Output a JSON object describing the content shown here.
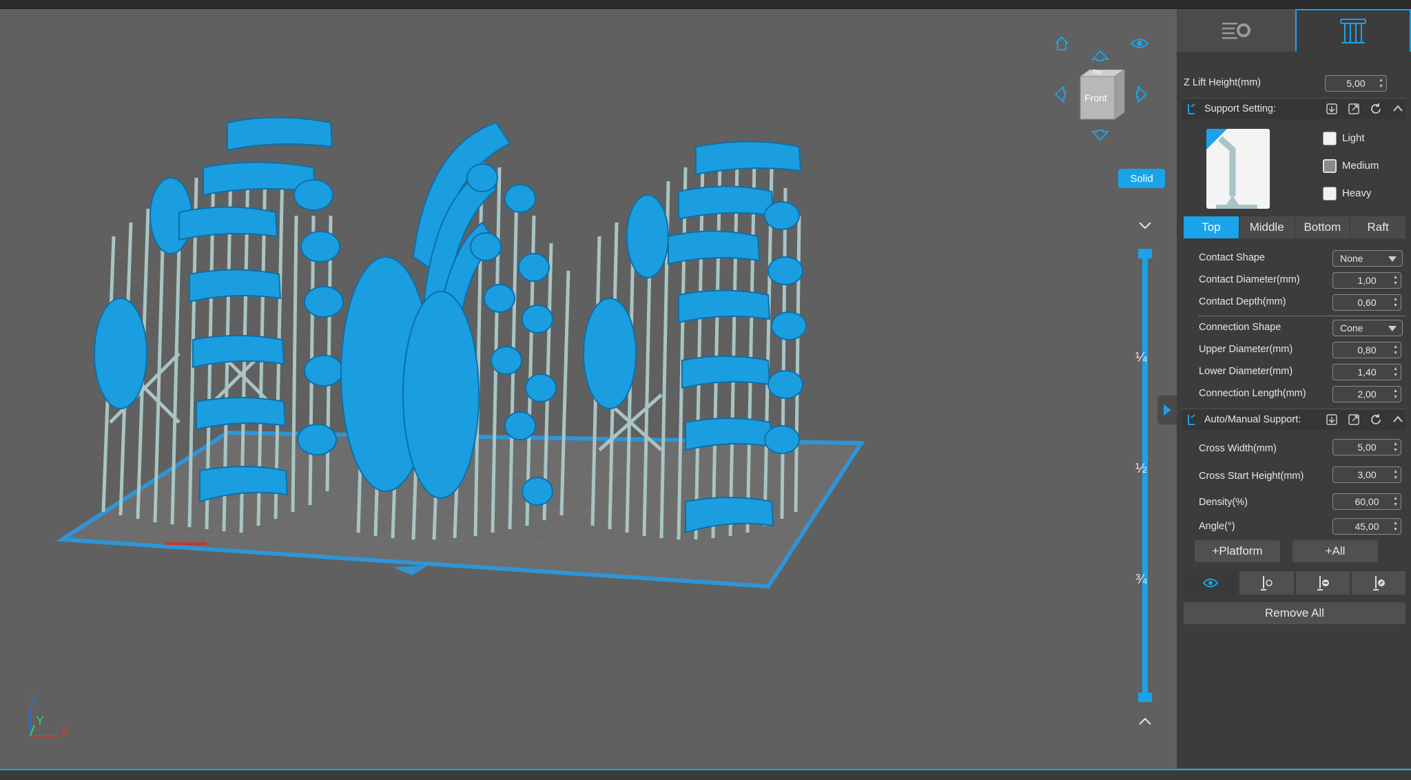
{
  "viewport": {
    "view_cube_face": "Front",
    "view_cube_top": "Top",
    "render_mode_label": "Solid",
    "slider_ticks": [
      "¼",
      "½",
      "¾"
    ],
    "axes": {
      "z": "Z",
      "y": "Y",
      "x": "X"
    }
  },
  "panel": {
    "z_lift": {
      "label": "Z Lift Height(mm)",
      "value": "5,00"
    },
    "support_setting": {
      "title": "Support Setting:",
      "presets": [
        {
          "label": "Light",
          "checked": false
        },
        {
          "label": "Medium",
          "checked": true
        },
        {
          "label": "Heavy",
          "checked": false
        }
      ],
      "tabs": [
        "Top",
        "Middle",
        "Bottom",
        "Raft"
      ],
      "active_tab": "Top",
      "contact_shape": {
        "label": "Contact Shape",
        "value": "None"
      },
      "contact_diameter": {
        "label": "Contact Diameter(mm)",
        "value": "1,00"
      },
      "contact_depth": {
        "label": "Contact Depth(mm)",
        "value": "0,60"
      },
      "connection_shape": {
        "label": "Connection Shape",
        "value": "Cone"
      },
      "upper_diameter": {
        "label": "Upper Diameter(mm)",
        "value": "0,80"
      },
      "lower_diameter": {
        "label": "Lower Diameter(mm)",
        "value": "1,40"
      },
      "connection_length": {
        "label": "Connection Length(mm)",
        "value": "2,00"
      }
    },
    "auto_manual": {
      "title": "Auto/Manual Support:",
      "cross_width": {
        "label": "Cross Width(mm)",
        "value": "5,00"
      },
      "cross_start_height": {
        "label": "Cross Start Height(mm)",
        "value": "3,00"
      },
      "density": {
        "label": "Density(%)",
        "value": "60,00"
      },
      "angle": {
        "label": "Angle(°)",
        "value": "45,00"
      },
      "platform_button": "+Platform",
      "all_button": "+All",
      "remove_all_button": "Remove All"
    }
  },
  "colors": {
    "accent": "#1aa3e8",
    "model": "#1a9ee0",
    "support": "#a9c4c4",
    "panel_bg": "#3c3c3c",
    "viewport_bg": "#606060"
  }
}
